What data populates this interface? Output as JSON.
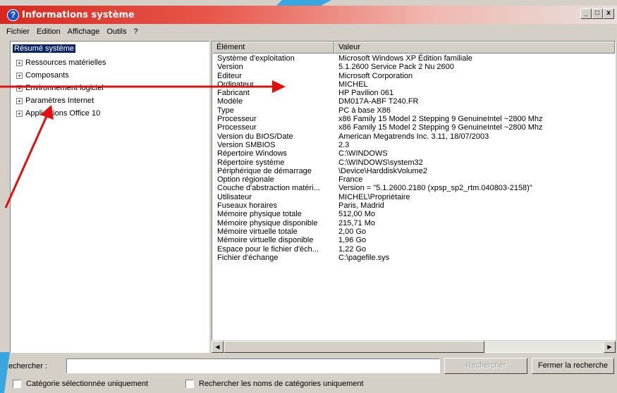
{
  "window": {
    "title": "Informations système",
    "controls": [
      "_",
      "□",
      "x"
    ]
  },
  "menu": [
    "Fichier",
    "Edition",
    "Affichage",
    "Outils",
    "?"
  ],
  "tree": {
    "root": "Résumé système",
    "nodes": [
      "Ressources matérielles",
      "Composants",
      "Environnement logiciel",
      "Paramètres Internet",
      "Applications Office 10"
    ]
  },
  "list": {
    "headers": {
      "element": "Élément",
      "value": "Valeur"
    },
    "rows": [
      [
        "Système d'exploitation",
        "Microsoft Windows XP Édition familiale"
      ],
      [
        "Version",
        "5.1.2600 Service Pack 2 Nu 2600"
      ],
      [
        "Éditeur",
        "Microsoft Corporation"
      ],
      [
        "Ordinateur",
        "MICHEL"
      ],
      [
        "Fabricant",
        "HP Pavilion 061"
      ],
      [
        "Modèle",
        "DM017A-ABF T240.FR"
      ],
      [
        "Type",
        "PC à base X86"
      ],
      [
        "Processeur",
        "x86 Family 15 Model 2 Stepping 9 GenuineIntel ~2800 Mhz"
      ],
      [
        "Processeur",
        "x86 Family 15 Model 2 Stepping 9 GenuineIntel ~2800 Mhz"
      ],
      [
        "Version du BIOS/Date",
        "American Megatrends Inc. 3.11, 18/07/2003"
      ],
      [
        "Version SMBIOS",
        "2.3"
      ],
      [
        "Répertoire Windows",
        "C:\\WINDOWS"
      ],
      [
        "Répertoire système",
        "C:\\WINDOWS\\system32"
      ],
      [
        "Périphérique de démarrage",
        "\\Device\\HarddiskVolume2"
      ],
      [
        "Option régionale",
        "France"
      ],
      [
        "Couche d'abstraction matéri...",
        "Version = \"5.1.2600.2180 (xpsp_sp2_rtm.040803-2158)\""
      ],
      [
        "Utilisateur",
        "MICHEL\\Propriétaire"
      ],
      [
        "Fuseaux horaires",
        "Paris, Madrid"
      ],
      [
        "Mémoire physique totale",
        "512,00 Mo"
      ],
      [
        "Mémoire physique disponible",
        "215,71 Mo"
      ],
      [
        "Mémoire virtuelle totale",
        "2,00 Go"
      ],
      [
        "Mémoire virtuelle disponible",
        "1,96 Go"
      ],
      [
        "Espace pour le fichier d'éch...",
        "1,22 Go"
      ],
      [
        "Fichier d'échange",
        "C:\\pagefile.sys"
      ]
    ]
  },
  "search": {
    "label": "Rechercher :",
    "value": "",
    "search_button": "Rechercher",
    "close_button": "Fermer la recherche",
    "option_selected_category": "Catégorie sélectionnée uniquement",
    "option_category_names": "Rechercher les noms de catégories uniquement"
  },
  "colors": {
    "title_gradient_start": "#d62a1d",
    "selection": "#0a246a",
    "annotation_arrow": "#e01010"
  }
}
